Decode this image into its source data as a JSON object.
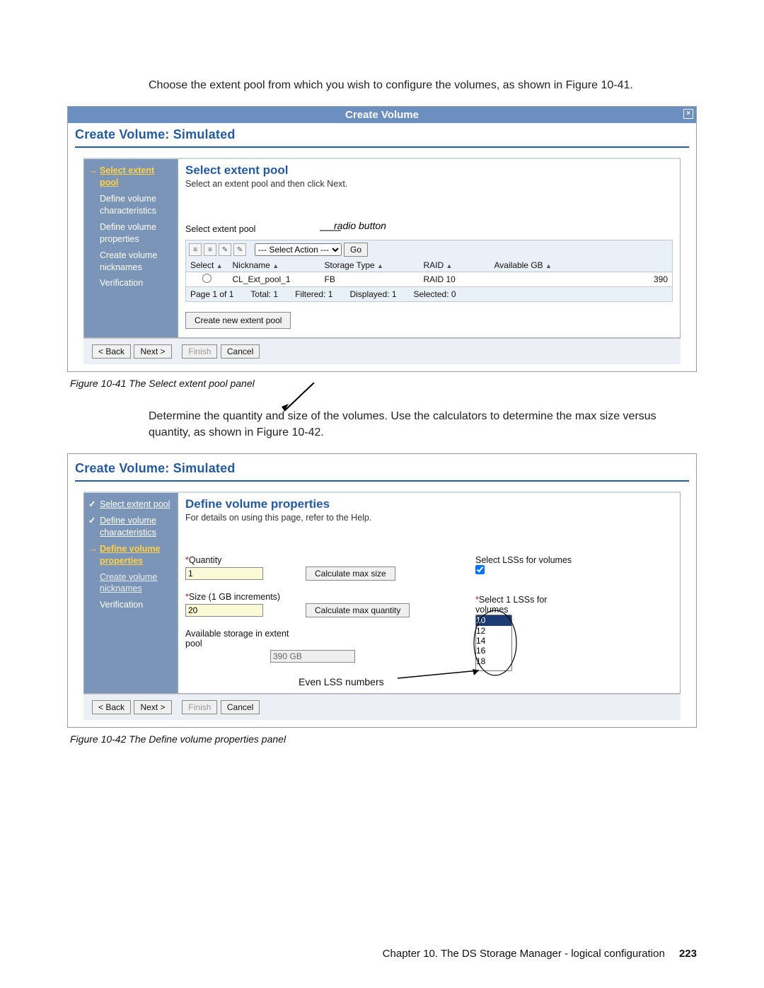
{
  "intro1": "Choose the extent pool from which you wish to configure the volumes, as shown in Figure 10-41.",
  "intro2": "Determine the quantity and size of the volumes. Use the calculators to determine the max size versus quantity, as shown in Figure 10-42.",
  "caption1": "Figure 10-41   The Select extent pool panel",
  "caption2": "Figure 10-42   The Define volume properties panel",
  "footer": {
    "chapter": "Chapter 10. The DS Storage Manager - logical configuration",
    "page": "223"
  },
  "fig1": {
    "titleBar": "Create Volume",
    "subtitle": "Create Volume: Simulated",
    "sectionTitle": "Select extent pool",
    "sectionSub": "Select an extent pool and then click Next.",
    "label_select": "Select extent pool",
    "annot_radio": "radio button",
    "side_steps": {
      "s1": "Select extent pool",
      "s2": "Define volume characteristics",
      "s3": "Define volume properties",
      "s4": "Create volume nicknames",
      "s5": "Verification"
    },
    "toolbar": {
      "actionPlaceholder": "--- Select Action ---",
      "go": "Go"
    },
    "columns": {
      "c0": "Select",
      "c1": "Nickname",
      "c2": "Storage Type",
      "c3": "RAID",
      "c4": "Available GB"
    },
    "row": {
      "nickname": "CL_Ext_pool_1",
      "stype": "FB",
      "raid": "RAID 10",
      "avail": "390"
    },
    "pager": {
      "page": "Page 1 of 1",
      "total": "Total: 1",
      "filtered": "Filtered: 1",
      "displayed": "Displayed: 1",
      "selected": "Selected: 0"
    },
    "createPoolBtn": "Create new extent pool",
    "nav": {
      "back": "< Back",
      "next": "Next >",
      "finish": "Finish",
      "cancel": "Cancel"
    }
  },
  "fig2": {
    "subtitle": "Create Volume: Simulated",
    "sectionTitle": "Define volume properties",
    "sectionSub": "For details on using this page, refer to the Help.",
    "side_steps": {
      "s1": "Select extent pool",
      "s2": "Define volume characteristics",
      "s3": "Define volume properties",
      "s4": "Create volume nicknames",
      "s5": "Verification"
    },
    "labels": {
      "qty": "Quantity",
      "size": "Size (1 GB increments)",
      "avail": "Available storage in extent pool",
      "selLSS": "Select LSSs for volumes",
      "sel1LSS": "Select 1 LSSs for volumes",
      "calcSize": "Calculate max size",
      "calcQty": "Calculate max quantity",
      "evenLSS": "Even LSS numbers"
    },
    "values": {
      "qty": "1",
      "size": "20",
      "avail": "390 GB"
    },
    "lss_options": [
      "10",
      "12",
      "14",
      "16",
      "18"
    ],
    "nav": {
      "back": "< Back",
      "next": "Next >",
      "finish": "Finish",
      "cancel": "Cancel"
    }
  }
}
